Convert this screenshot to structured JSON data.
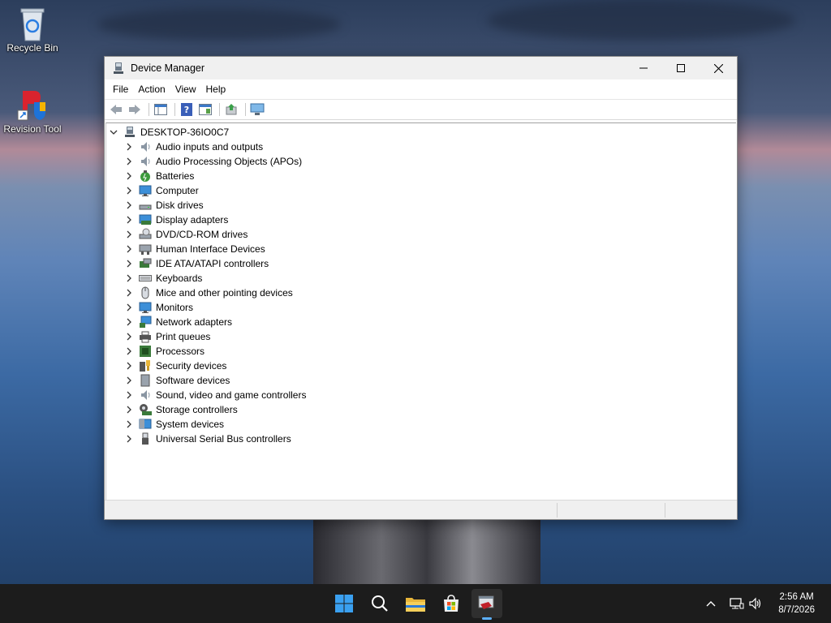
{
  "desktop": {
    "icons": [
      {
        "label": "Recycle Bin"
      },
      {
        "label": "Revision Tool"
      }
    ]
  },
  "window": {
    "title": "Device Manager",
    "menu": [
      "File",
      "Action",
      "View",
      "Help"
    ],
    "tree": {
      "root": "DESKTOP-36IO0C7",
      "items": [
        {
          "label": "Audio inputs and outputs",
          "icon": "speaker-icon"
        },
        {
          "label": "Audio Processing Objects (APOs)",
          "icon": "speaker-icon"
        },
        {
          "label": "Batteries",
          "icon": "battery-icon"
        },
        {
          "label": "Computer",
          "icon": "monitor-icon"
        },
        {
          "label": "Disk drives",
          "icon": "disk-drive-icon"
        },
        {
          "label": "Display adapters",
          "icon": "display-adapter-icon"
        },
        {
          "label": "DVD/CD-ROM drives",
          "icon": "dvd-drive-icon"
        },
        {
          "label": "Human Interface Devices",
          "icon": "hid-icon"
        },
        {
          "label": "IDE ATA/ATAPI controllers",
          "icon": "ide-controller-icon"
        },
        {
          "label": "Keyboards",
          "icon": "keyboard-icon"
        },
        {
          "label": "Mice and other pointing devices",
          "icon": "mouse-icon"
        },
        {
          "label": "Monitors",
          "icon": "monitor-icon"
        },
        {
          "label": "Network adapters",
          "icon": "network-adapter-icon"
        },
        {
          "label": "Print queues",
          "icon": "printer-icon"
        },
        {
          "label": "Processors",
          "icon": "processor-icon"
        },
        {
          "label": "Security devices",
          "icon": "security-device-icon"
        },
        {
          "label": "Software devices",
          "icon": "software-device-icon"
        },
        {
          "label": "Sound, video and game controllers",
          "icon": "speaker-icon"
        },
        {
          "label": "Storage controllers",
          "icon": "storage-controller-icon"
        },
        {
          "label": "System devices",
          "icon": "system-device-icon"
        },
        {
          "label": "Universal Serial Bus controllers",
          "icon": "usb-icon"
        }
      ]
    }
  },
  "taskbar": {
    "clock": {
      "time": "2:56 AM",
      "date": "8/7/2026"
    }
  },
  "colors": {
    "accent": "#0078d4",
    "taskbar": "#1c1c1c"
  }
}
